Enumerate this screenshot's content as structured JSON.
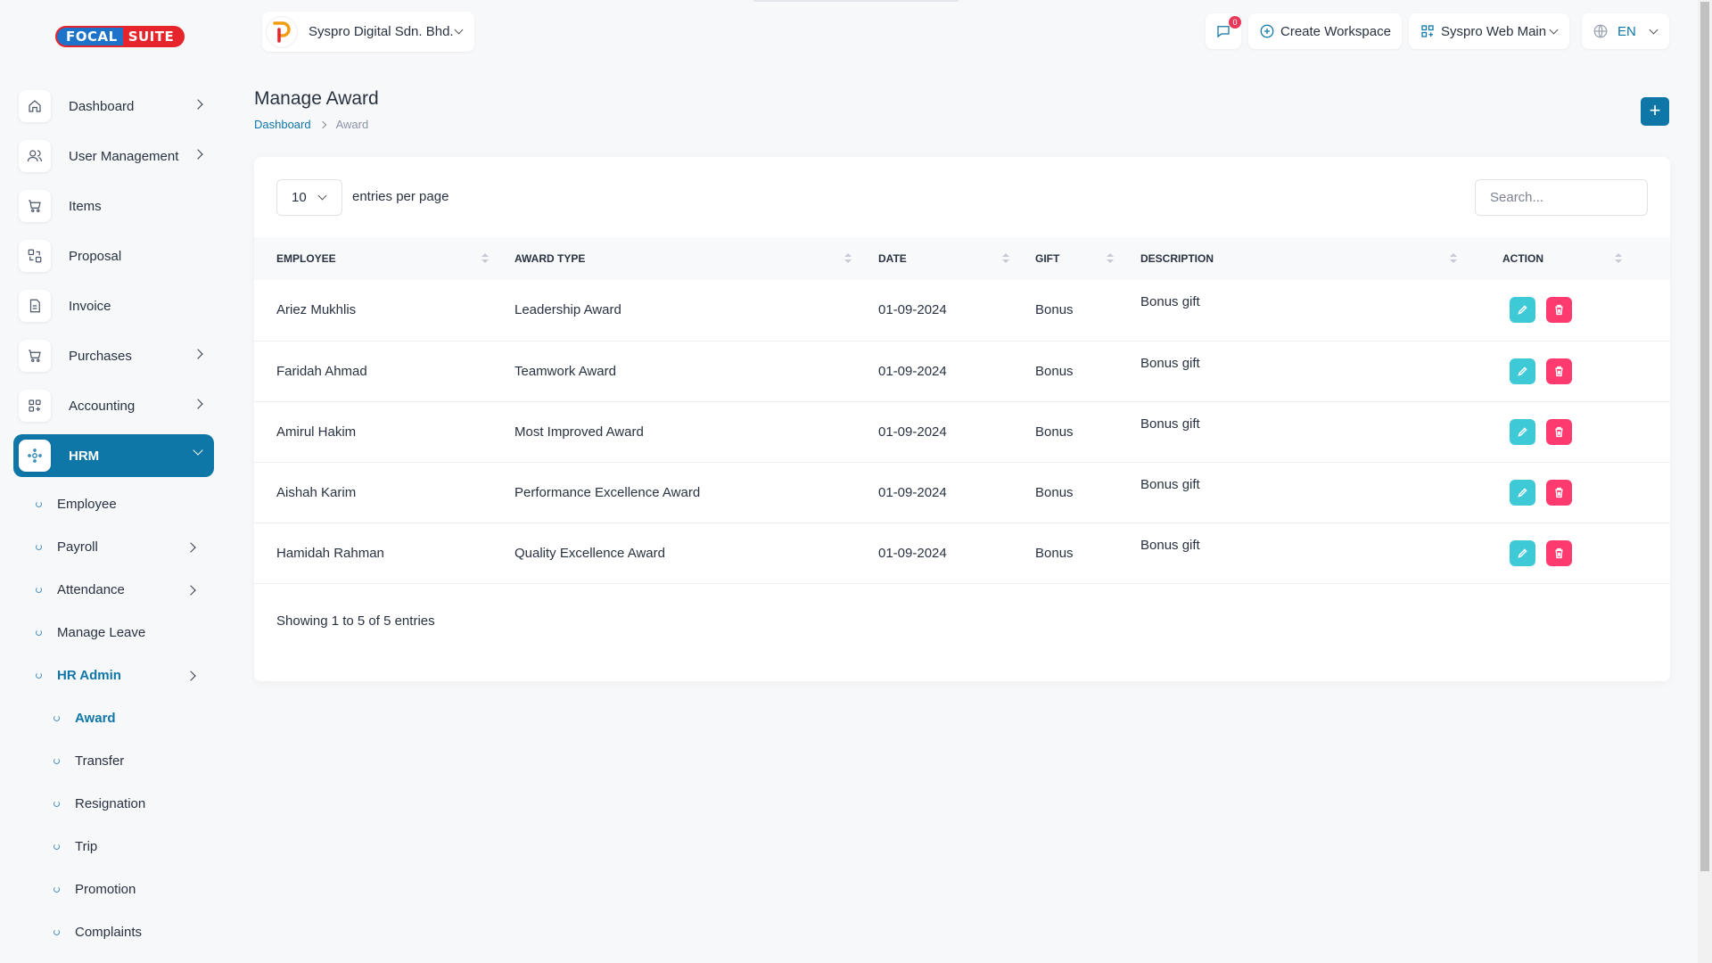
{
  "app": {
    "logo_left": "FOCAL",
    "logo_right": "SUITE"
  },
  "sidebar": {
    "items": [
      {
        "label": "Dashboard",
        "icon": "home-icon",
        "has_children": true
      },
      {
        "label": "User Management",
        "icon": "users-icon",
        "has_children": true
      },
      {
        "label": "Items",
        "icon": "cart-icon",
        "has_children": false
      },
      {
        "label": "Proposal",
        "icon": "proposal-icon",
        "has_children": false
      },
      {
        "label": "Invoice",
        "icon": "invoice-icon",
        "has_children": false
      },
      {
        "label": "Purchases",
        "icon": "cart-icon",
        "has_children": true
      },
      {
        "label": "Accounting",
        "icon": "grid-icon",
        "has_children": true
      },
      {
        "label": "HRM",
        "icon": "hrm-icon",
        "has_children": true,
        "active": true
      }
    ],
    "hrm_sub": [
      {
        "label": "Employee"
      },
      {
        "label": "Payroll",
        "has_children": true
      },
      {
        "label": "Attendance",
        "has_children": true
      },
      {
        "label": "Manage Leave"
      },
      {
        "label": "HR Admin",
        "has_children": true,
        "active": true
      }
    ],
    "hr_admin_sub": [
      {
        "label": "Award",
        "active": true
      },
      {
        "label": "Transfer"
      },
      {
        "label": "Resignation"
      },
      {
        "label": "Trip"
      },
      {
        "label": "Promotion"
      },
      {
        "label": "Complaints"
      }
    ]
  },
  "header": {
    "company": "Syspro Digital Sdn. Bhd.",
    "notification_count": "0",
    "create_workspace": "Create Workspace",
    "workspace": "Syspro Web Main",
    "language": "EN"
  },
  "page": {
    "title": "Manage Award",
    "breadcrumb_home": "Dashboard",
    "breadcrumb_current": "Award",
    "add_label": "+"
  },
  "table": {
    "per_page": "10",
    "per_page_label": "entries per page",
    "search_placeholder": "Search...",
    "columns": [
      "EMPLOYEE",
      "AWARD TYPE",
      "DATE",
      "GIFT",
      "DESCRIPTION",
      "ACTION"
    ],
    "rows": [
      {
        "employee": "Ariez Mukhlis",
        "award_type": "Leadership Award",
        "date": "01-09-2024",
        "gift": "Bonus",
        "description": "Bonus gift"
      },
      {
        "employee": "Faridah Ahmad",
        "award_type": "Teamwork Award",
        "date": "01-09-2024",
        "gift": "Bonus",
        "description": "Bonus gift"
      },
      {
        "employee": "Amirul Hakim",
        "award_type": "Most Improved Award",
        "date": "01-09-2024",
        "gift": "Bonus",
        "description": "Bonus gift"
      },
      {
        "employee": "Aishah Karim",
        "award_type": "Performance Excellence Award",
        "date": "01-09-2024",
        "gift": "Bonus",
        "description": "Bonus gift"
      },
      {
        "employee": "Hamidah Rahman",
        "award_type": "Quality Excellence Award",
        "date": "01-09-2024",
        "gift": "Bonus",
        "description": "Bonus gift"
      }
    ],
    "showing": "Showing 1 to 5 of 5 entries"
  },
  "colors": {
    "primary": "#0f76a8",
    "edit": "#3ec9d6",
    "delete": "#ff3a6e",
    "badge": "#e8385b"
  }
}
